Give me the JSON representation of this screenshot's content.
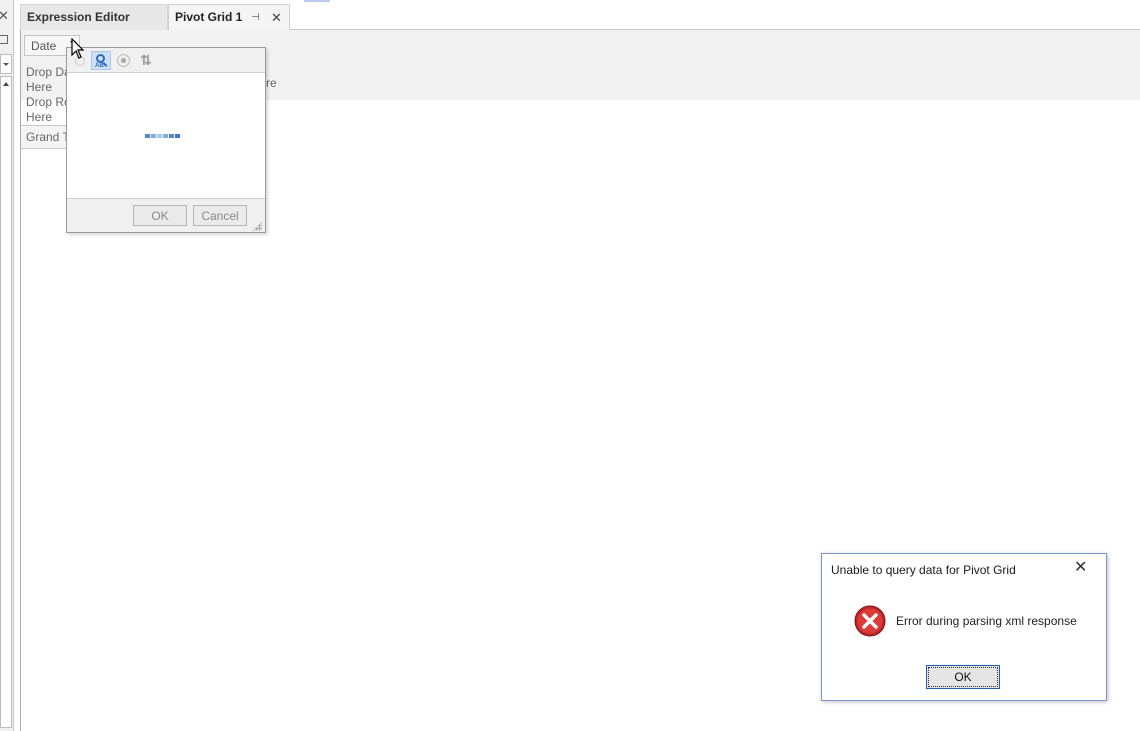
{
  "tabs": [
    {
      "label": "Expression Editor",
      "active": false
    },
    {
      "label": "Pivot Grid 1",
      "active": true
    }
  ],
  "pivot": {
    "field_button": "Date",
    "drop_data_text": "Drop Da",
    "drop_data_text_cont": "Here",
    "drop_row_text": "Drop Ro",
    "drop_row_text_cont": "Here",
    "drop_column_tail": "re",
    "grand_total": "Grand T"
  },
  "filter_popup": {
    "ok_label": "OK",
    "cancel_label": "Cancel",
    "toolbar_icons": [
      "search-icon",
      "radio-icon",
      "sort-icon"
    ],
    "loading": true
  },
  "error_dialog": {
    "title": "Unable to query data for Pivot Grid",
    "message": "Error during parsing xml response",
    "ok_label": "OK",
    "icon": "error-icon"
  },
  "colors": {
    "accent": "#1e5eb3",
    "error_red": "#d2232a",
    "loader": [
      "#4f88cf",
      "#82ace0",
      "#a9c8ec",
      "#82ace0",
      "#4f88cf",
      "#3a78c8"
    ]
  }
}
